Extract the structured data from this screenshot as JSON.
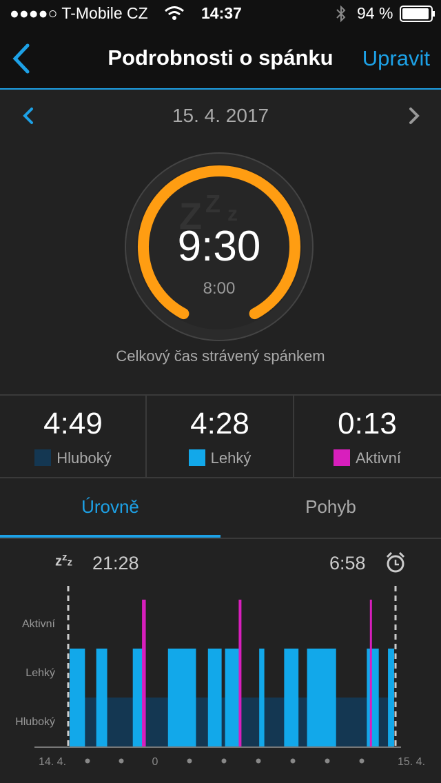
{
  "status_bar": {
    "carrier": "●●●●○ T-Mobile CZ",
    "time": "14:37",
    "battery": "94 %"
  },
  "nav": {
    "title": "Podrobnosti o spánku",
    "edit_label": "Upravit"
  },
  "date": "15. 4. 2017",
  "summary": {
    "total": "9:30",
    "goal": "8:00",
    "total_label": "Celkový čas strávený spánkem"
  },
  "stats": [
    {
      "value": "4:49",
      "label": "Hluboký",
      "color": "#143752"
    },
    {
      "value": "4:28",
      "label": "Lehký",
      "color": "#12a8ea"
    },
    {
      "value": "0:13",
      "label": "Aktivní",
      "color": "#d81fbd"
    }
  ],
  "tabs": {
    "levels": "Úrovně",
    "motion": "Pohyb"
  },
  "chart_header": {
    "start": "21:28",
    "end": "6:58"
  },
  "colors": {
    "accent": "#1da1e6",
    "ring": "#ff9d12",
    "deep": "#143752",
    "light": "#12a8ea",
    "active": "#d81fbd"
  },
  "chart_data": {
    "type": "bar",
    "y_categories": [
      "Hluboký",
      "Lehký",
      "Aktivní"
    ],
    "x_ticks": [
      "14. 4.",
      "0",
      "15. 4."
    ],
    "x_range": [
      "21:28",
      "6:58"
    ],
    "x_unit": "hours since 21:28",
    "deep_baseline": [
      0.24,
      9.5
    ],
    "light_segments": [
      [
        0,
        0.45
      ],
      [
        0.78,
        1.1
      ],
      [
        1.85,
        2.2
      ],
      [
        2.88,
        3.7
      ],
      [
        4.05,
        4.45
      ],
      [
        4.55,
        4.98
      ],
      [
        5.55,
        5.7
      ],
      [
        6.28,
        6.7
      ],
      [
        6.95,
        7.8
      ],
      [
        8.7,
        9.05
      ],
      [
        9.32,
        9.5
      ]
    ],
    "active_spikes": [
      2.15,
      2.2,
      4.98,
      5.0,
      8.82
    ]
  }
}
